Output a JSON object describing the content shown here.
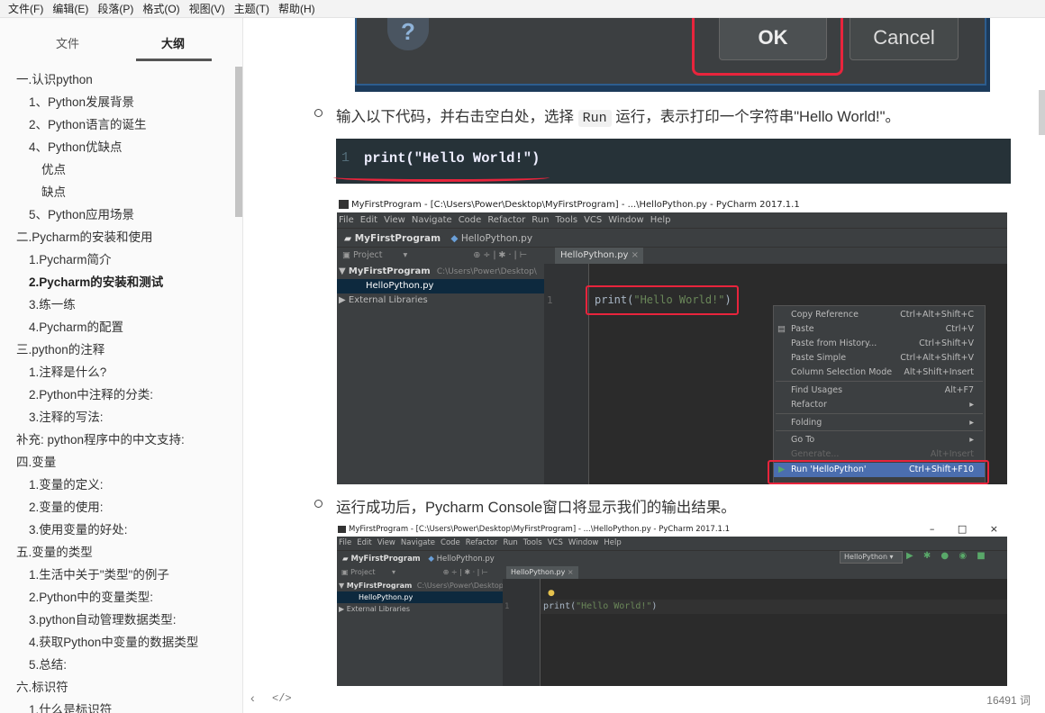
{
  "menubar": [
    "文件(F)",
    "编辑(E)",
    "段落(P)",
    "格式(O)",
    "视图(V)",
    "主题(T)",
    "帮助(H)"
  ],
  "sidebar": {
    "tabs": [
      "文件",
      "大纲"
    ],
    "outline": [
      {
        "level": 1,
        "text": "一.认识python"
      },
      {
        "level": 2,
        "text": "1、Python发展背景"
      },
      {
        "level": 2,
        "text": "2、Python语言的诞生"
      },
      {
        "level": 2,
        "text": "4、Python优缺点"
      },
      {
        "level": 3,
        "text": "优点"
      },
      {
        "level": 3,
        "text": "缺点"
      },
      {
        "level": 2,
        "text": "5、Python应用场景"
      },
      {
        "level": 1,
        "text": "二.Pycharm的安装和使用"
      },
      {
        "level": 2,
        "text": "1.Pycharm简介"
      },
      {
        "level": 2,
        "text": "2.Pycharm的安装和测试",
        "active": true
      },
      {
        "level": 2,
        "text": "3.练一练"
      },
      {
        "level": 2,
        "text": "4.Pycharm的配置"
      },
      {
        "level": 1,
        "text": "三.python的注释"
      },
      {
        "level": 2,
        "text": "1.注释是什么?"
      },
      {
        "level": 2,
        "text": "2.Python中注释的分类:"
      },
      {
        "level": 2,
        "text": "3.注释的写法:"
      },
      {
        "level": 1,
        "text": "补充: python程序中的中文支持:"
      },
      {
        "level": 1,
        "text": "四.变量"
      },
      {
        "level": 2,
        "text": "1.变量的定义:"
      },
      {
        "level": 2,
        "text": "2.变量的使用:"
      },
      {
        "level": 2,
        "text": "3.使用变量的好处:"
      },
      {
        "level": 1,
        "text": "五.变量的类型"
      },
      {
        "level": 2,
        "text": "1.生活中关于\"类型\"的例子"
      },
      {
        "level": 2,
        "text": "2.Python中的变量类型:"
      },
      {
        "level": 2,
        "text": "3.python自动管理数据类型:"
      },
      {
        "level": 2,
        "text": "4.获取Python中变量的数据类型"
      },
      {
        "level": 2,
        "text": "5.总结:"
      },
      {
        "level": 1,
        "text": "六.标识符"
      },
      {
        "level": 2,
        "text": "1.什么是标识符"
      }
    ]
  },
  "dialog": {
    "help": "?",
    "ok": "OK",
    "cancel": "Cancel"
  },
  "content": {
    "bullet1_pre": "输入以下代码，并右击空白处，选择",
    "bullet1_code": "Run",
    "bullet1_post": "运行，表示打印一个字符串\"Hello World!\"。",
    "code_lineno": "1",
    "code_line": "print(\"Hello World!\")",
    "bullet2": "运行成功后，Pycharm Console窗口将显示我们的输出结果。"
  },
  "shot1": {
    "title": "MyFirstProgram - [C:\\Users\\Power\\Desktop\\MyFirstProgram] - ...\\HelloPython.py - PyCharm 2017.1.1",
    "menus": [
      "File",
      "Edit",
      "View",
      "Navigate",
      "Code",
      "Refactor",
      "Run",
      "Tools",
      "VCS",
      "Window",
      "Help"
    ],
    "nav_project": "MyFirstProgram",
    "nav_file": "HelloPython.py",
    "proj_label": "Project",
    "tab": "HelloPython.py",
    "tree_root": "MyFirstProgram",
    "tree_root_path": "C:\\Users\\Power\\Desktop\\",
    "tree_file": "HelloPython.py",
    "tree_ext": "External Libraries",
    "lineno": "1",
    "code_fn": "print(",
    "code_str": "\"Hello World!\"",
    "code_end": ")",
    "ctx": [
      {
        "label": "Copy Reference",
        "key": "Ctrl+Alt+Shift+C"
      },
      {
        "label": "Paste",
        "key": "Ctrl+V"
      },
      {
        "label": "Paste from History...",
        "key": "Ctrl+Shift+V"
      },
      {
        "label": "Paste Simple",
        "key": "Ctrl+Alt+Shift+V"
      },
      {
        "label": "Column Selection Mode",
        "key": "Alt+Shift+Insert"
      },
      {
        "label": "Find Usages",
        "key": "Alt+F7"
      },
      {
        "label": "Refactor",
        "key": "▸"
      },
      {
        "label": "Folding",
        "key": "▸"
      },
      {
        "label": "Go To",
        "key": "▸"
      },
      {
        "label": "Generate...",
        "key": "Alt+Insert"
      },
      {
        "label": "Run 'HelloPython'",
        "key": "Ctrl+Shift+F10"
      }
    ]
  },
  "shot2": {
    "title": "MyFirstProgram - [C:\\Users\\Power\\Desktop\\MyFirstProgram] - ...\\HelloPython.py - PyCharm 2017.1.1",
    "win_buttons": [
      "–",
      "□",
      "×"
    ],
    "menus": [
      "File",
      "Edit",
      "View",
      "Navigate",
      "Code",
      "Refactor",
      "Run",
      "Tools",
      "VCS",
      "Window",
      "Help"
    ],
    "nav_project": "MyFirstProgram",
    "nav_file": "HelloPython.py",
    "run_config": "HelloPython ▾",
    "run_icons": "▶ ✱ ● ◉ ■",
    "proj_label": "Project",
    "tab": "HelloPython.py",
    "tree_root": "MyFirstProgram",
    "tree_root_path": "C:\\Users\\Power\\Desktop\\",
    "tree_file": "HelloPython.py",
    "tree_ext": "External Libraries",
    "lineno": "1",
    "code_fn": "print(",
    "code_str": "\"Hello World!\"",
    "code_end": ")"
  },
  "bottombar": {
    "back": "‹",
    "source": "</>",
    "wordcount": "16491 词"
  }
}
